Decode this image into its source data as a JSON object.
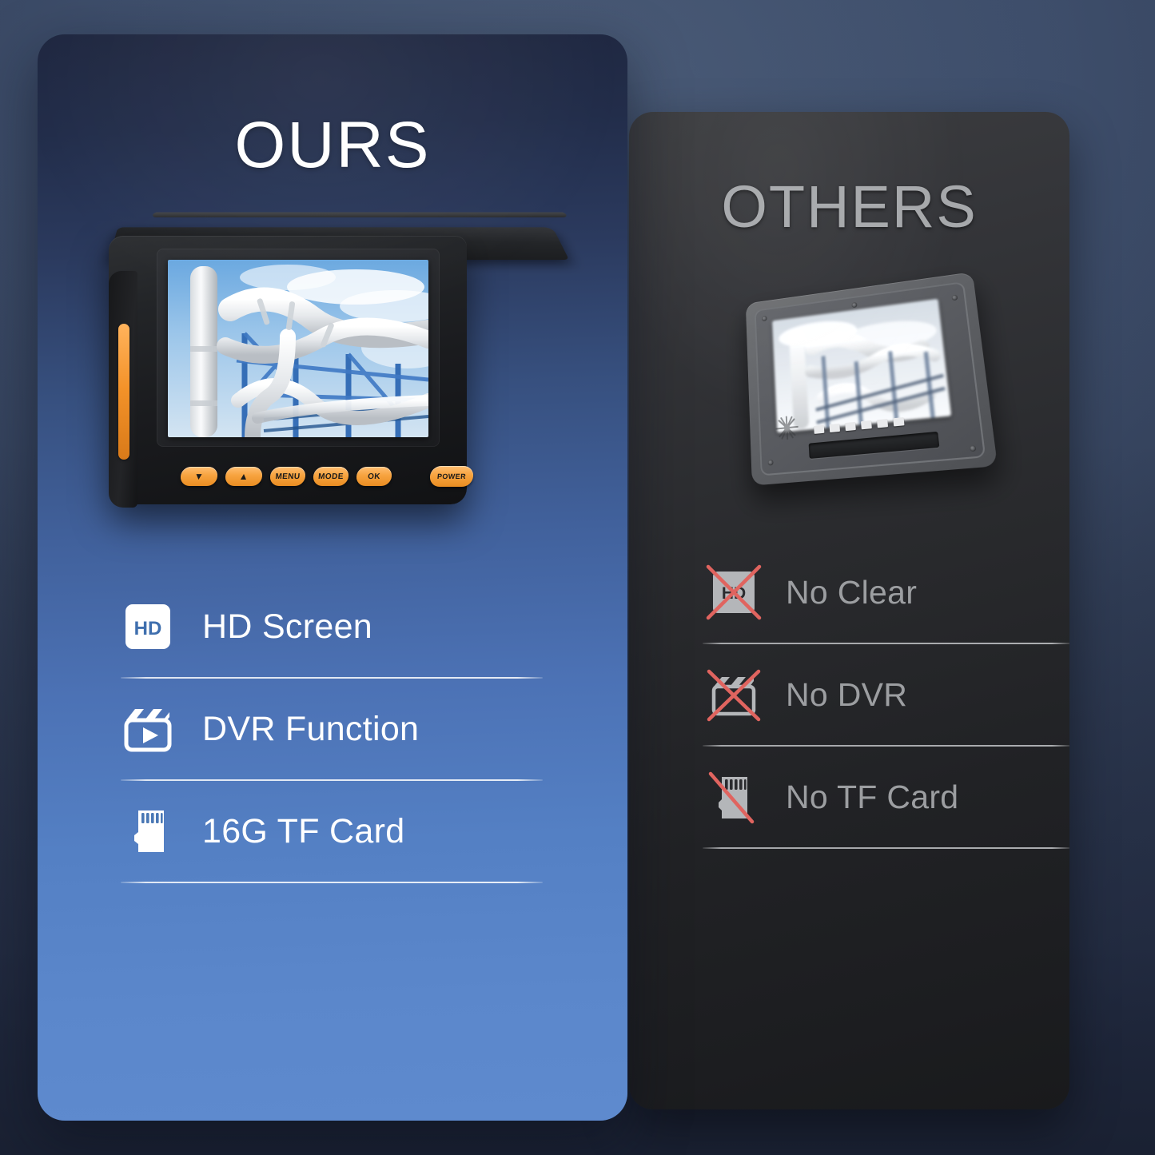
{
  "theme": {
    "page_bg_top": "#4b5c78",
    "page_bg_bottom": "#27314a",
    "ours_card_top": "#1f2740",
    "ours_card_bottom": "#5e8ace",
    "others_card_top": "#3c3d40",
    "others_card_bottom": "#191a1c",
    "ours_text": "#ffffff",
    "others_text": "#9c9ea1",
    "accent_orange": "#f7a33f",
    "cross_red": "#e0645f",
    "icon_white": "#ffffff",
    "icon_gray": "#b4b6b9"
  },
  "ours": {
    "title": "OURS",
    "device": {
      "name": "handheld-inspection-monitor",
      "buttons": [
        {
          "name": "down-button",
          "label": "▼"
        },
        {
          "name": "up-button",
          "label": "▲"
        },
        {
          "name": "menu-button",
          "label": "MENU"
        },
        {
          "name": "mode-button",
          "label": "MODE"
        },
        {
          "name": "ok-button",
          "label": "OK"
        },
        {
          "name": "power-button",
          "label": "POWER"
        }
      ],
      "screen_content": "industrial pipeline photo, sharp"
    },
    "features": [
      {
        "icon": "hd-badge-icon",
        "label": "HD Screen"
      },
      {
        "icon": "clapperboard-play-icon",
        "label": "DVR Function"
      },
      {
        "icon": "microsd-card-icon",
        "label": "16G TF Card"
      }
    ]
  },
  "others": {
    "title": "OTHERS",
    "device": {
      "name": "competitor-monitor",
      "screen_content": "industrial pipeline photo, blurred and desaturated"
    },
    "features": [
      {
        "icon": "hd-badge-crossed-icon",
        "label": "No Clear",
        "mark": "x"
      },
      {
        "icon": "clapperboard-crossed-icon",
        "label": "No DVR",
        "mark": "x"
      },
      {
        "icon": "microsd-card-slashed-icon",
        "label": "No TF Card",
        "mark": "slash"
      }
    ]
  }
}
